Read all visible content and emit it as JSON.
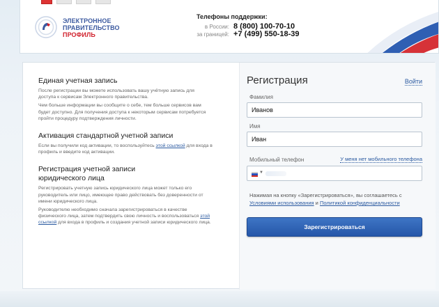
{
  "header": {
    "logo": {
      "line1": "ЭЛЕКТРОННОЕ",
      "line2": "ПРАВИТЕЛЬСТВО",
      "line3": "ПРОФИЛЬ"
    },
    "phones_title": "Телефоны поддержки:",
    "phones": [
      {
        "label": "в России:",
        "number": "8 (800) 100-70-10"
      },
      {
        "label": "за границей:",
        "number": "+7 (499) 550-18-39"
      }
    ],
    "colors": {
      "brand_blue": "#3c5aa0",
      "brand_red": "#d0212c"
    }
  },
  "info": {
    "sections": [
      {
        "title": "Единая учетная запись",
        "paragraphs": [
          "После регистрации вы можете использовать вашу учётную запись для доступа к сервисам Электронного правительства.",
          "Чем больше информации вы сообщите о себе, тем больше сервисов вам будет доступно. Для получения доступа к некоторым сервисам потребуется пройти процедуру подтверждения личности."
        ]
      },
      {
        "title": "Активация стандартной учетной записи",
        "text_before": "Если вы получили код активации, то воспользуйтесь ",
        "link": "этой ссылкой",
        "text_after": " для входа в профиль и введите код активации."
      },
      {
        "title": "Регистрация учетной записи юридического лица",
        "paragraph1": "Регистрировать учетную запись юридического лица может только его руководитель или лицо, имеющее право действовать без доверенности от имени юридического лица.",
        "text_before": "Руководителю необходимо сначала зарегистрироваться в качестве физического лица, затем подтвердить свою личность и воспользоваться ",
        "link": "этой ссылкой",
        "text_after": " для входа в профиль и создания учетной записи юридического лица."
      }
    ]
  },
  "registration": {
    "title": "Регистрация",
    "login_link": "Войти",
    "surname_label": "Фамилия",
    "surname_value": "Иванов",
    "name_label": "Имя",
    "name_value": "Иван",
    "phone_label": "Мобильный телефон",
    "no_mobile_link": "У меня нет мобильного телефона",
    "agree_text": "Нажимая на кнопку «Зарегистрироваться», вы соглашаетесь с ",
    "terms_link": "Условиями использования",
    "and_text": " и ",
    "privacy_link": "Политикой конфиденциальности",
    "submit_label": "Зарегистрироваться",
    "colors": {
      "button": "#2f64b5",
      "link": "#2b5aa0"
    }
  }
}
